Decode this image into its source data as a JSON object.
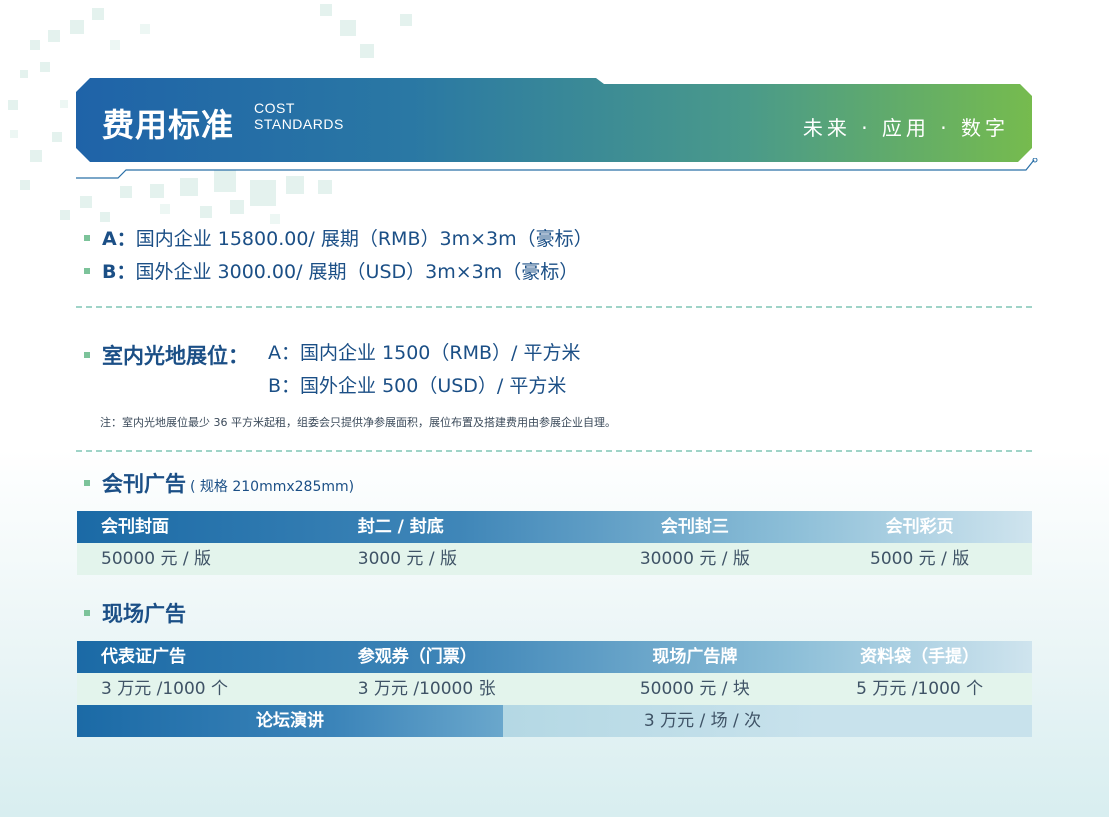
{
  "banner": {
    "title": "费用标准",
    "en_line1": "COST",
    "en_line2": "STANDARDS",
    "slogan": "未来 · 应用 · 数字"
  },
  "prices": {
    "a_label": "A：",
    "a_text": "国内企业 15800.00/ 展期（RMB）3m×3m（豪标）",
    "b_label": "B：",
    "b_text": "国外企业 3000.00/ 展期（USD）3m×3m（豪标）"
  },
  "indoor": {
    "title": "室内光地展位：",
    "a": "A：国内企业 1500（RMB）/ 平方米",
    "b": "B：国外企业 500（USD）/ 平方米",
    "note": "注：室内光地展位最少 36 平方米起租，组委会只提供净参展面积，展位布置及搭建费用由参展企业自理。"
  },
  "journal_ads": {
    "title": "会刊广告",
    "spec": "( 规格 210mmx285mm)",
    "headers": [
      "会刊封面",
      "封二 / 封底",
      "会刊封三",
      "会刊彩页"
    ],
    "values": [
      "50000 元 / 版",
      "3000 元 / 版",
      "30000 元 / 版",
      "5000 元 / 版"
    ]
  },
  "onsite_ads": {
    "title": "现场广告",
    "headers": [
      "代表证广告",
      "参观券（门票）",
      "现场广告牌",
      "资料袋（手提）"
    ],
    "values": [
      "3 万元 /1000 个",
      "3 万元 /10000 张",
      "50000 元 / 块",
      "5 万元 /1000 个"
    ],
    "forum_label": "论坛演讲",
    "forum_value": "3 万元 / 场 / 次"
  }
}
